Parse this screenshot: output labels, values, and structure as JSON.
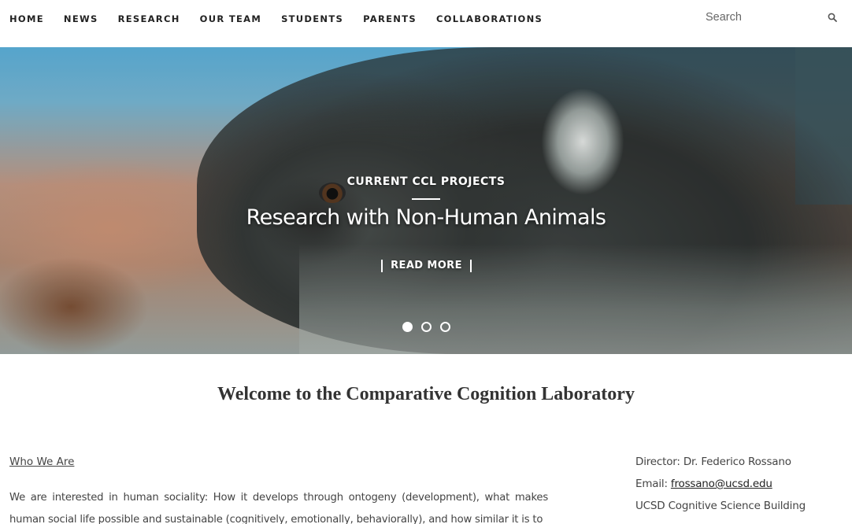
{
  "nav": {
    "items": [
      {
        "label": "HOME"
      },
      {
        "label": "NEWS"
      },
      {
        "label": "RESEARCH"
      },
      {
        "label": "OUR TEAM"
      },
      {
        "label": "STUDENTS"
      },
      {
        "label": "PARENTS"
      },
      {
        "label": "COLLABORATIONS"
      }
    ]
  },
  "search": {
    "placeholder": "Search",
    "icon": "search-icon"
  },
  "hero": {
    "eyebrow": "CURRENT CCL PROJECTS",
    "title": "Research with Non-Human Animals",
    "button_label": "READ MORE",
    "slides_total": 3,
    "active_slide": 1
  },
  "main": {
    "welcome_title": "Welcome to the Comparative Cognition Laboratory",
    "who_heading": "Who We Are",
    "intro_text": "We are interested in human sociality: How it develops through ontogeny (development), what makes human social life possible and sustainable (cognitively, emotionally, behaviorally), and how similar it is to"
  },
  "contact": {
    "director": "Director: Dr. Federico Rossano",
    "email_label": "Email: ",
    "email": "frossano@ucsd.edu",
    "building": "UCSD Cognitive Science Building"
  }
}
